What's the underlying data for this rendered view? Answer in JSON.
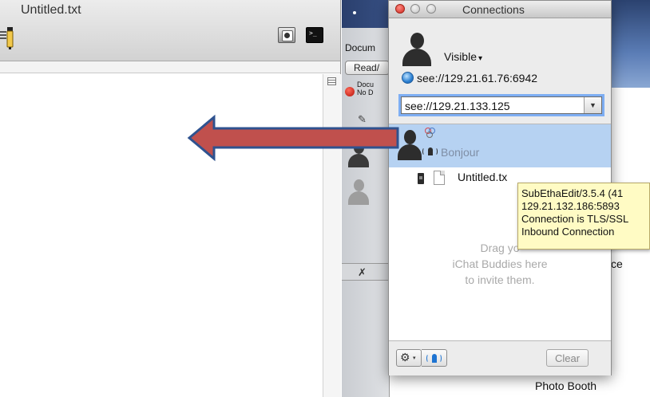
{
  "editor": {
    "title": "Untitled.txt",
    "terminal_glyph": ">_"
  },
  "background_window": {
    "docum_label": "Docum",
    "read_button_label": "Read/",
    "doc_label_line1": "Docu",
    "doc_label_line2": "No D",
    "partial_text": "ce",
    "photo_booth_label": "Photo Booth"
  },
  "connections": {
    "title": "Connections",
    "visibility_label": "Visible",
    "visibility_caret": "▾",
    "own_address": "see://129.21.61.76:6942",
    "address_input_value": "see://129.21.133.125",
    "address_dropdown_glyph": "▼",
    "rows": [
      {
        "label": "Bonjour"
      }
    ],
    "shared_document": "Untitled.tx",
    "drop_hint_line1": "Drag yo",
    "drop_hint_line2": "iChat Buddies here",
    "drop_hint_line3": "to invite them.",
    "gear_glyph": "⚙",
    "gear_caret": "▾",
    "clear_button_label": "Clear"
  },
  "tooltip": {
    "lines": [
      "SubEthaEdit/3.5.4 (41",
      "129.21.132.186:5893",
      "Connection is TLS/SSL",
      "Inbound Connection"
    ]
  },
  "colors": {
    "selection": "#b6d2f2",
    "arrow_fill": "#c0504d",
    "arrow_stroke": "#2f528f",
    "tooltip_bg": "#fffbc4"
  }
}
